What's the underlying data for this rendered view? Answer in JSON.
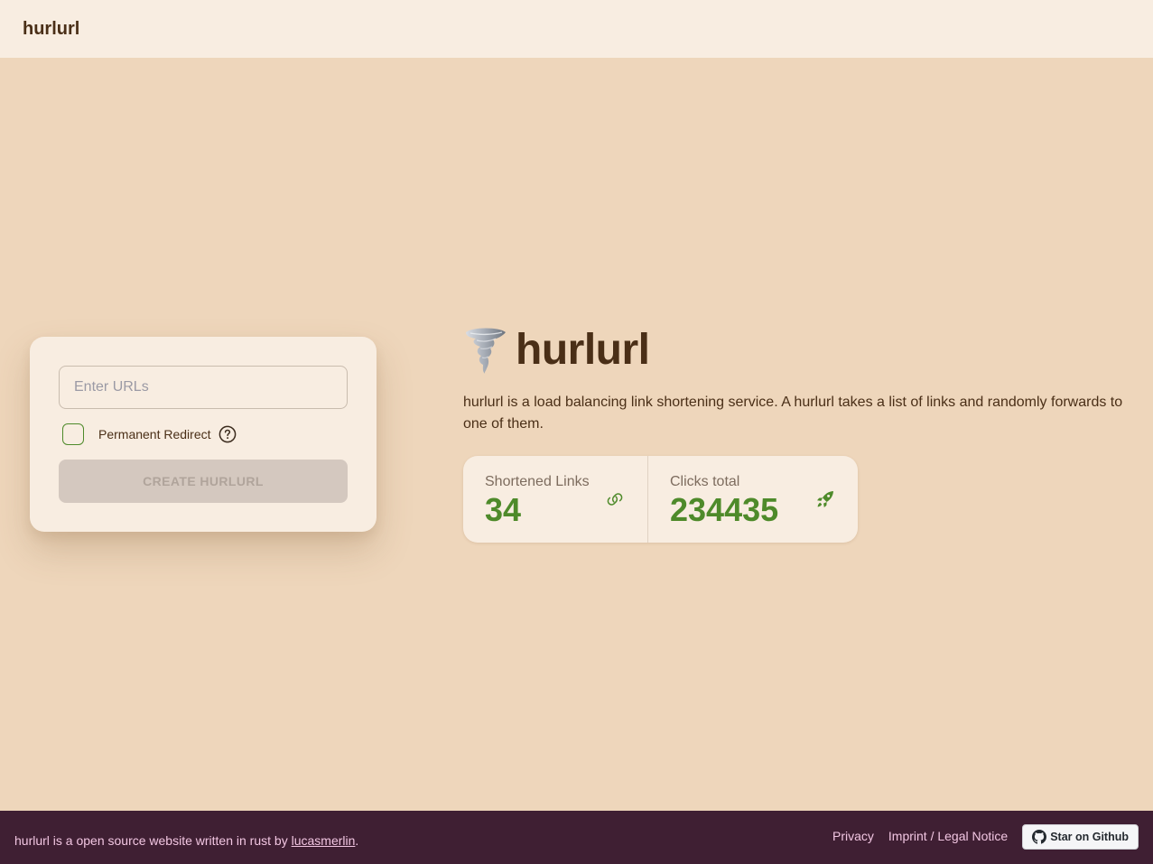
{
  "navbar": {
    "brand": "hurlurl"
  },
  "form": {
    "url_placeholder": "Enter URLs",
    "url_value": "",
    "redirect_label": "Permanent Redirect",
    "redirect_checked": false,
    "create_label": "CREATE HURLURL"
  },
  "hero": {
    "icon": "tornado-icon",
    "title": "hurlurl",
    "description": "hurlurl is a load balancing link shortening service. A hurlurl takes a list of links and randomly forwards to one of them."
  },
  "stats": [
    {
      "title": "Shortened Links",
      "value": "34",
      "icon": "link-icon"
    },
    {
      "title": "Clicks total",
      "value": "234435",
      "icon": "rocket-icon"
    }
  ],
  "footer": {
    "text_before": "hurlurl is a open source website written in rust by ",
    "author": "lucasmerlin",
    "text_after": ".",
    "privacy": "Privacy",
    "imprint": "Imprint / Legal Notice",
    "github": "Star on Github"
  },
  "colors": {
    "background": "#eed6bb",
    "surface": "#f8ede1",
    "text": "#4a2f17",
    "accent": "#4e8a2a",
    "footer": "#3f1f33",
    "footer_text": "#f2c6e2"
  }
}
